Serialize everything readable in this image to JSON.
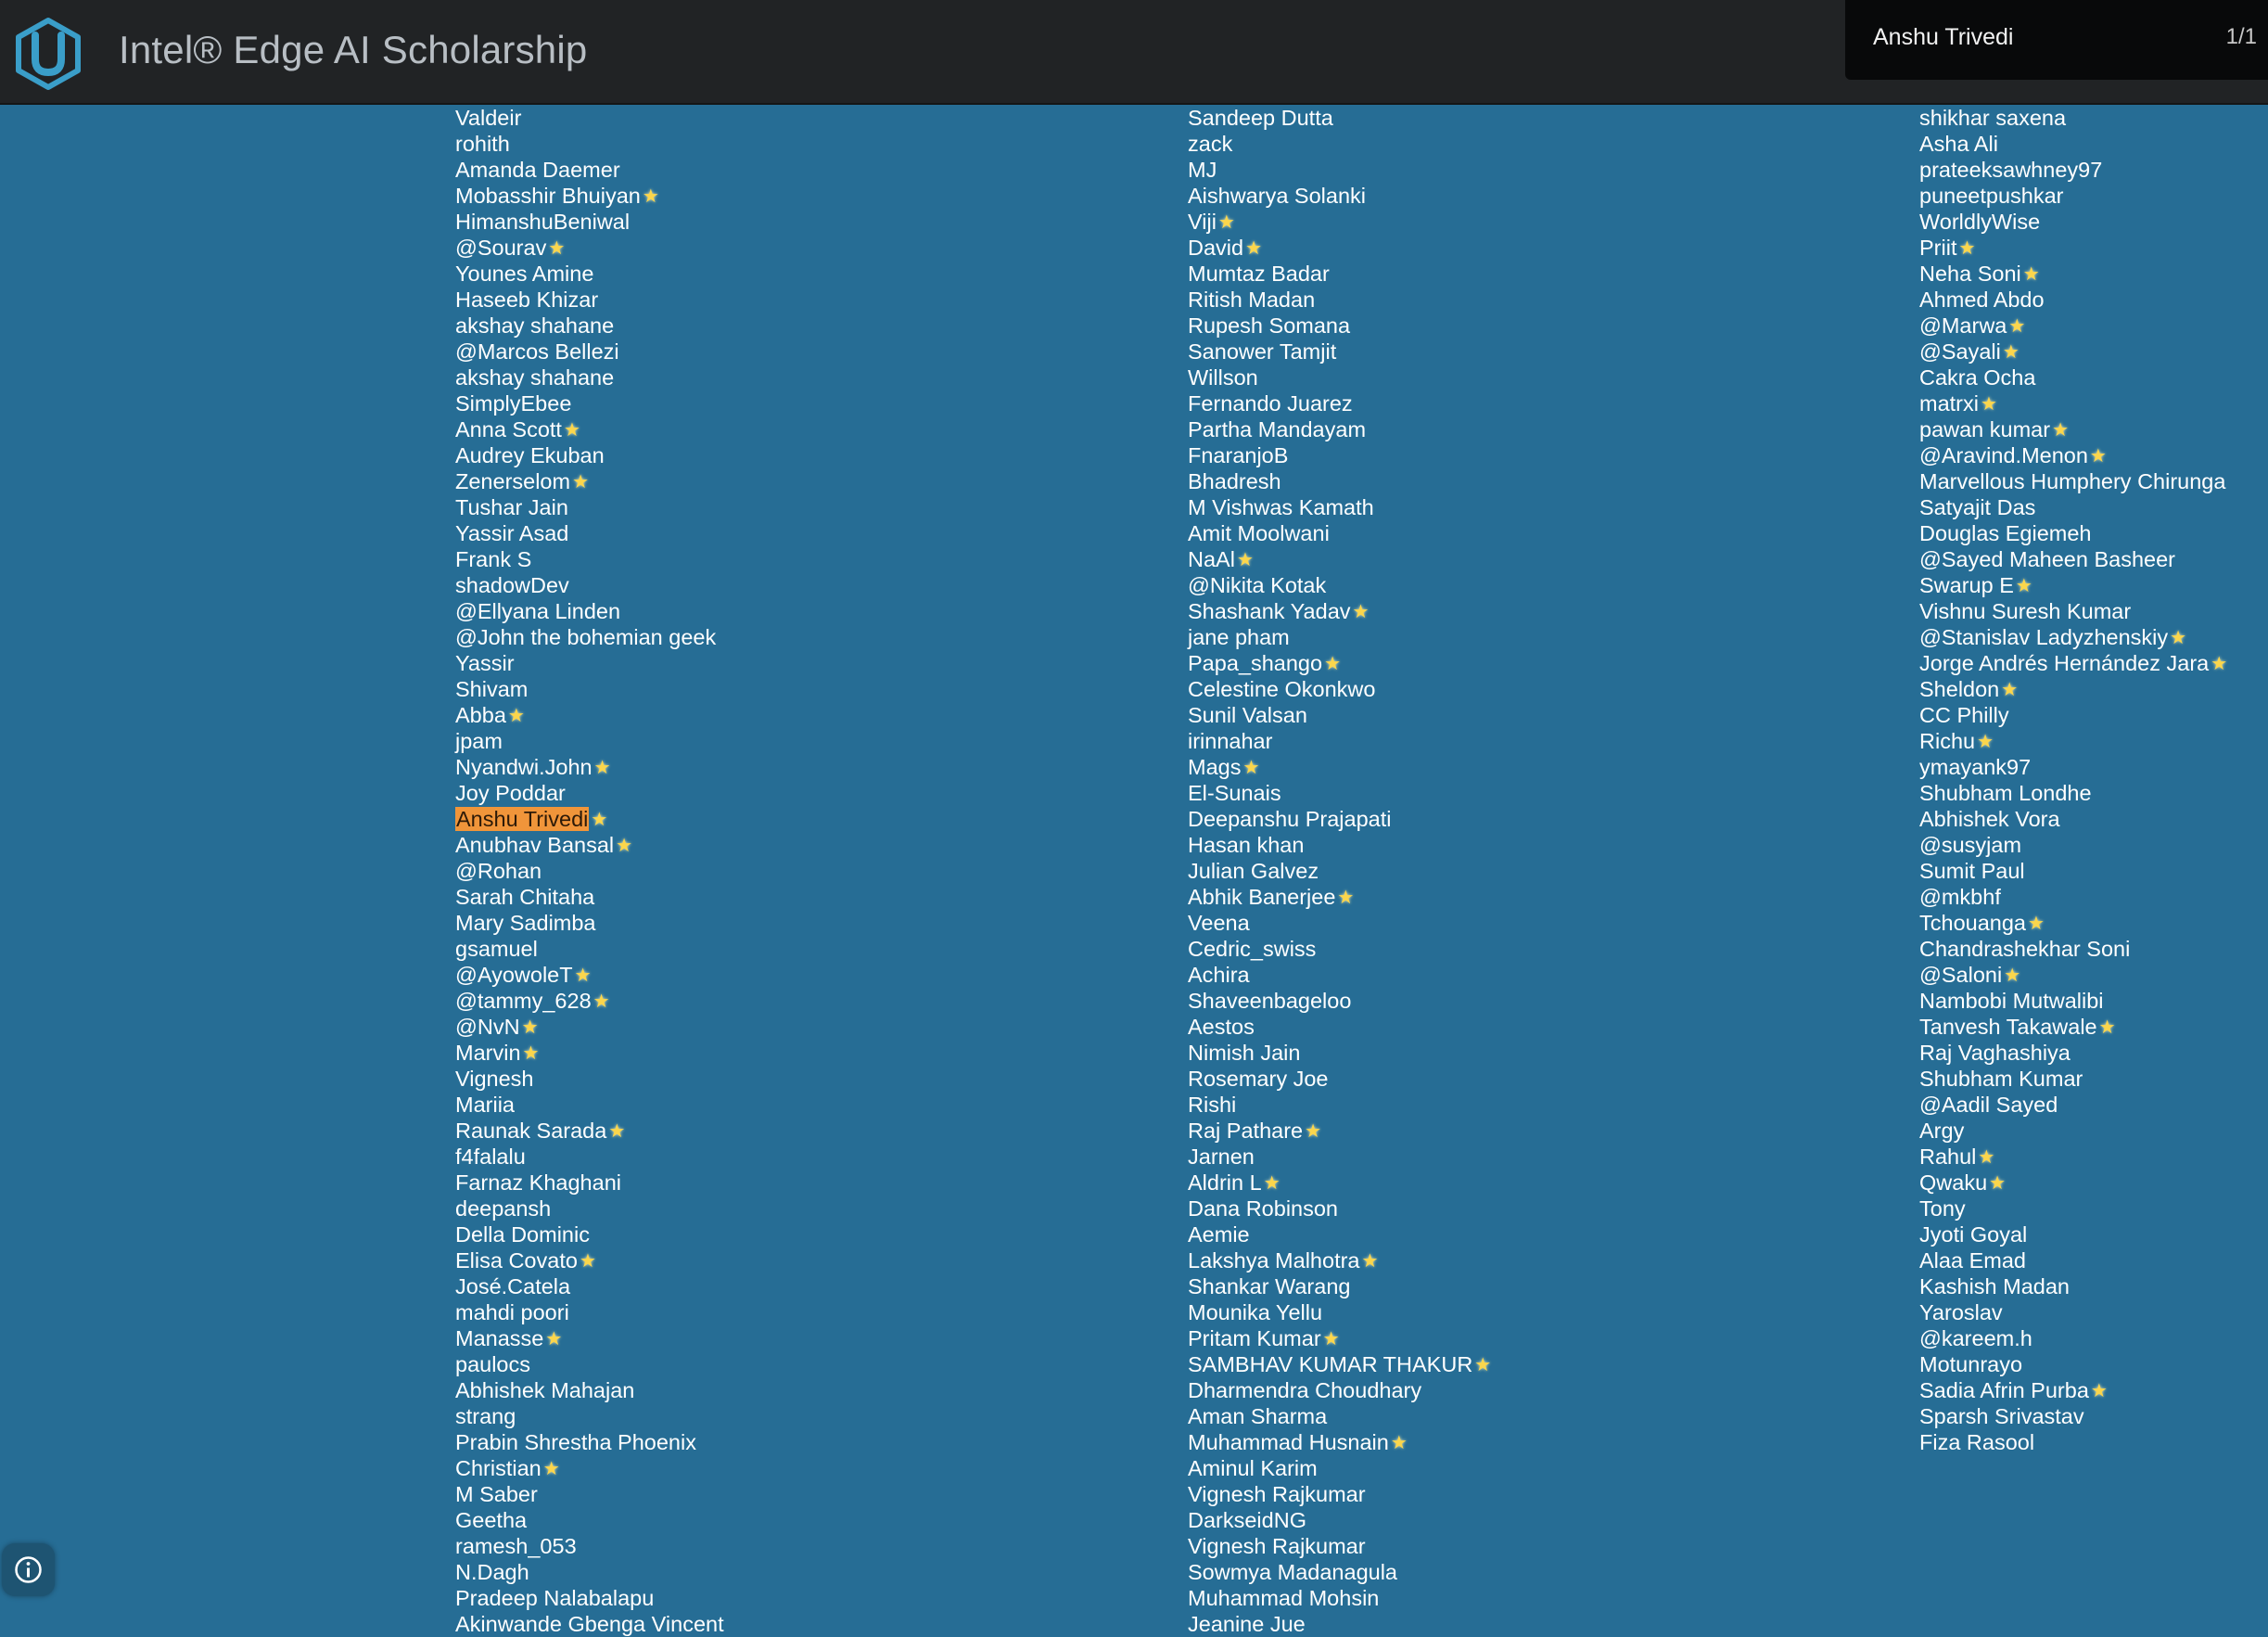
{
  "header": {
    "title": "Intel® Edge AI Scholarship",
    "logo_icon": "udacity-u-logo-icon"
  },
  "find_bar": {
    "query": "Anshu Trivedi",
    "match_count": "1/1"
  },
  "highlight_color": "#f0953a",
  "star_icon": "sparkle-star-icon",
  "columns": [
    [
      {
        "name": "Valdeir"
      },
      {
        "name": "rohith"
      },
      {
        "name": "Amanda Daemer"
      },
      {
        "name": "Mobasshir Bhuiyan",
        "star": true
      },
      {
        "name": "HimanshuBeniwal"
      },
      {
        "name": "@Sourav",
        "star": true
      },
      {
        "name": "Younes Amine"
      },
      {
        "name": "Haseeb Khizar"
      },
      {
        "name": "akshay shahane"
      },
      {
        "name": "@Marcos Bellezi"
      },
      {
        "name": "akshay shahane"
      },
      {
        "name": "SimplyEbee"
      },
      {
        "name": "Anna Scott",
        "star": true
      },
      {
        "name": "Audrey Ekuban"
      },
      {
        "name": "Zenerselom",
        "star": true
      },
      {
        "name": "Tushar Jain"
      },
      {
        "name": "Yassir Asad"
      },
      {
        "name": "Frank S"
      },
      {
        "name": "shadowDev"
      },
      {
        "name": "@Ellyana Linden"
      },
      {
        "name": "@John the bohemian geek"
      },
      {
        "name": "Yassir"
      },
      {
        "name": "Shivam"
      },
      {
        "name": "Abba",
        "star": true
      },
      {
        "name": "jpam"
      },
      {
        "name": "Nyandwi.John",
        "star": true
      },
      {
        "name": "Joy Poddar"
      },
      {
        "name": "Anshu Trivedi",
        "star": true,
        "highlight": true
      },
      {
        "name": "Anubhav Bansal",
        "star": true
      },
      {
        "name": "@Rohan"
      },
      {
        "name": "Sarah Chitaha"
      },
      {
        "name": "Mary Sadimba"
      },
      {
        "name": "gsamuel"
      },
      {
        "name": "@AyowoleT",
        "star": true
      },
      {
        "name": "@tammy_628",
        "star": true
      },
      {
        "name": "@NvN",
        "star": true
      },
      {
        "name": "Marvin",
        "star": true
      },
      {
        "name": "Vignesh"
      },
      {
        "name": "Mariia"
      },
      {
        "name": "Raunak Sarada",
        "star": true
      },
      {
        "name": "f4falalu"
      },
      {
        "name": "Farnaz Khaghani"
      },
      {
        "name": "deepansh"
      },
      {
        "name": "Della Dominic"
      },
      {
        "name": "Elisa Covato",
        "star": true
      },
      {
        "name": "José.Catela"
      },
      {
        "name": "mahdi poori"
      },
      {
        "name": "Manasse",
        "star": true
      },
      {
        "name": "paulocs"
      },
      {
        "name": "Abhishek Mahajan"
      },
      {
        "name": "strang"
      },
      {
        "name": "Prabin Shrestha Phoenix"
      },
      {
        "name": "Christian",
        "star": true
      },
      {
        "name": "M Saber"
      },
      {
        "name": "Geetha"
      },
      {
        "name": "ramesh_053"
      },
      {
        "name": "N.Dagh"
      },
      {
        "name": "Pradeep Nalabalapu"
      },
      {
        "name": "Akinwande Gbenga Vincent"
      }
    ],
    [
      {
        "name": "Sandeep Dutta"
      },
      {
        "name": "zack"
      },
      {
        "name": "MJ"
      },
      {
        "name": "Aishwarya Solanki"
      },
      {
        "name": "Viji",
        "star": true
      },
      {
        "name": "David",
        "star": true
      },
      {
        "name": "Mumtaz Badar"
      },
      {
        "name": "Ritish Madan"
      },
      {
        "name": "Rupesh Somana"
      },
      {
        "name": "Sanower Tamjit"
      },
      {
        "name": "Willson"
      },
      {
        "name": "Fernando Juarez"
      },
      {
        "name": "Partha Mandayam"
      },
      {
        "name": "FnaranjoB"
      },
      {
        "name": "Bhadresh"
      },
      {
        "name": "M Vishwas Kamath"
      },
      {
        "name": "Amit Moolwani"
      },
      {
        "name": "NaAl",
        "star": true
      },
      {
        "name": "@Nikita Kotak"
      },
      {
        "name": "Shashank Yadav",
        "star": true
      },
      {
        "name": "jane pham"
      },
      {
        "name": "Papa_shango",
        "star": true
      },
      {
        "name": "Celestine Okonkwo"
      },
      {
        "name": "Sunil Valsan"
      },
      {
        "name": "irinnahar"
      },
      {
        "name": "Mags",
        "star": true
      },
      {
        "name": "El-Sunais"
      },
      {
        "name": "Deepanshu Prajapati"
      },
      {
        "name": "Hasan khan"
      },
      {
        "name": "Julian Galvez"
      },
      {
        "name": "Abhik Banerjee",
        "star": true
      },
      {
        "name": "Veena"
      },
      {
        "name": "Cedric_swiss"
      },
      {
        "name": "Achira"
      },
      {
        "name": "Shaveenbageloo"
      },
      {
        "name": "Aestos"
      },
      {
        "name": "Nimish Jain"
      },
      {
        "name": "Rosemary Joe"
      },
      {
        "name": "Rishi"
      },
      {
        "name": "Raj Pathare",
        "star": true
      },
      {
        "name": "Jarnen"
      },
      {
        "name": "Aldrin L",
        "star": true
      },
      {
        "name": "Dana Robinson"
      },
      {
        "name": "Aemie"
      },
      {
        "name": "Lakshya Malhotra",
        "star": true
      },
      {
        "name": "Shankar Warang"
      },
      {
        "name": "Mounika Yellu"
      },
      {
        "name": "Pritam Kumar",
        "star": true
      },
      {
        "name": "SAMBHAV KUMAR THAKUR",
        "star": true
      },
      {
        "name": "Dharmendra Choudhary"
      },
      {
        "name": "Aman Sharma"
      },
      {
        "name": "Muhammad Husnain",
        "star": true
      },
      {
        "name": "Aminul Karim"
      },
      {
        "name": "Vignesh Rajkumar"
      },
      {
        "name": "DarkseidNG"
      },
      {
        "name": "Vignesh Rajkumar"
      },
      {
        "name": "Sowmya Madanagula"
      },
      {
        "name": "Muhammad Mohsin"
      },
      {
        "name": "Jeanine Jue"
      }
    ],
    [
      {
        "name": "shikhar saxena"
      },
      {
        "name": "Asha Ali"
      },
      {
        "name": "prateeksawhney97"
      },
      {
        "name": "puneetpushkar"
      },
      {
        "name": "WorldlyWise"
      },
      {
        "name": "Priit",
        "star": true
      },
      {
        "name": "Neha Soni",
        "star": true
      },
      {
        "name": "Ahmed Abdo"
      },
      {
        "name": "@Marwa",
        "star": true
      },
      {
        "name": "@Sayali",
        "star": true
      },
      {
        "name": "Cakra Ocha"
      },
      {
        "name": "matrxi",
        "star": true
      },
      {
        "name": "pawan kumar",
        "star": true
      },
      {
        "name": "@Aravind.Menon",
        "star": true
      },
      {
        "name": "Marvellous Humphery Chirunga"
      },
      {
        "name": "Satyajit Das"
      },
      {
        "name": "Douglas Egiemeh"
      },
      {
        "name": "@Sayed Maheen Basheer"
      },
      {
        "name": "Swarup E",
        "star": true
      },
      {
        "name": "Vishnu Suresh Kumar"
      },
      {
        "name": "@Stanislav Ladyzhenskiy",
        "star": true
      },
      {
        "name": "Jorge Andrés Hernández Jara",
        "star": true
      },
      {
        "name": "Sheldon",
        "star": true
      },
      {
        "name": "CC Philly"
      },
      {
        "name": "Richu",
        "star": true
      },
      {
        "name": "ymayank97"
      },
      {
        "name": "Shubham Londhe"
      },
      {
        "name": "Abhishek Vora"
      },
      {
        "name": "@susyjam"
      },
      {
        "name": "Sumit Paul"
      },
      {
        "name": "@mkbhf"
      },
      {
        "name": "Tchouanga",
        "star": true
      },
      {
        "name": "Chandrashekhar Soni"
      },
      {
        "name": "@Saloni",
        "star": true
      },
      {
        "name": "Nambobi Mutwalibi"
      },
      {
        "name": "Tanvesh Takawale",
        "star": true
      },
      {
        "name": "Raj Vaghashiya"
      },
      {
        "name": "Shubham Kumar"
      },
      {
        "name": "@Aadil Sayed"
      },
      {
        "name": "Argy"
      },
      {
        "name": "Rahul",
        "star": true
      },
      {
        "name": "Qwaku",
        "star": true
      },
      {
        "name": "Tony"
      },
      {
        "name": "Jyoti Goyal"
      },
      {
        "name": "Alaa Emad"
      },
      {
        "name": "Kashish Madan"
      },
      {
        "name": "Yaroslav"
      },
      {
        "name": "@kareem.h"
      },
      {
        "name": "Motunrayo"
      },
      {
        "name": "Sadia Afrin Purba",
        "star": true
      },
      {
        "name": "Sparsh Srivastav"
      },
      {
        "name": "Fiza Rasool"
      }
    ]
  ],
  "info_icon": "info-icon"
}
